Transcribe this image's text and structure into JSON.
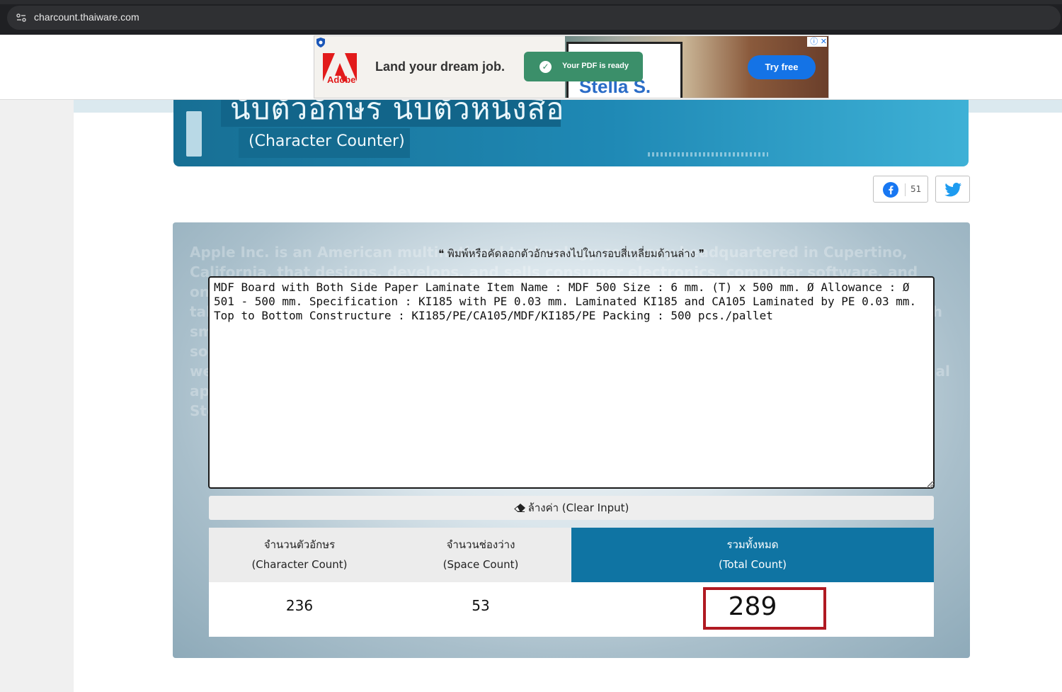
{
  "browser": {
    "url": "charcount.thaiware.com"
  },
  "ad": {
    "brand": "Adobe",
    "headline": "Land your dream job.",
    "toast": "Your PDF is ready",
    "screen_name": "Stella S.",
    "cta": "Try free"
  },
  "banner": {
    "title": "นับตัวอักษร นับตัวหนังสือ",
    "subtitle": "(Character Counter)"
  },
  "share": {
    "facebook_count": "51"
  },
  "tool": {
    "instruction": "❝ พิมพ์หรือคัดลอกตัวอักษรลงไปในกรอบสี่เหลี่ยมด้านล่าง ❞",
    "input_text": "MDF Board with Both Side Paper Laminate Item Name : MDF 500 Size : 6 mm. (T) x 500 mm. Ø Allowance : Ø 501 - 500 mm. Specification : KI185 with PE 0.03 mm. Laminated KI185 and CA105 Laminated by PE 0.03 mm. Top to Bottom Constructure : KI185/PE/CA105/MDF/KI185/PE Packing : 500 pcs./pallet",
    "clear_label": "ล้างค่า (Clear Input)",
    "background_text": "Apple Inc. is an American multinational technology company headquartered in Cupertino, California, that designs, develops, and sells consumer electronics, computer software, and online services. The company's hardware products include the iPhone smartphone, the iPad tablet computer, the Mac personal computer, the iPod portable media player, the Apple Watch smartwatch, the Apple TV digital media player, and the HomePod smart speaker. Apple's software includes the macOS and iOS operating systems, the iTunes media player, the Safari web browser, and the iLife and iWork creativity and productivity suites, as well as professional applications like Final Cut Pro, Logic Pro, and Xcode. Its online services include the iTunes Store, the iOS App Store and Mac App Store, Apple Music, and iCloud."
  },
  "counts": {
    "character": {
      "label_th": "จำนวนตัวอักษร",
      "label_en": "(Character Count)",
      "value": "236"
    },
    "space": {
      "label_th": "จำนวนช่องว่าง",
      "label_en": "(Space Count)",
      "value": "53"
    },
    "total": {
      "label_th": "รวมทั้งหมด",
      "label_en": "(Total Count)",
      "value": "289"
    }
  },
  "colors": {
    "accent": "#0f74a3",
    "highlight": "#b01a22"
  }
}
